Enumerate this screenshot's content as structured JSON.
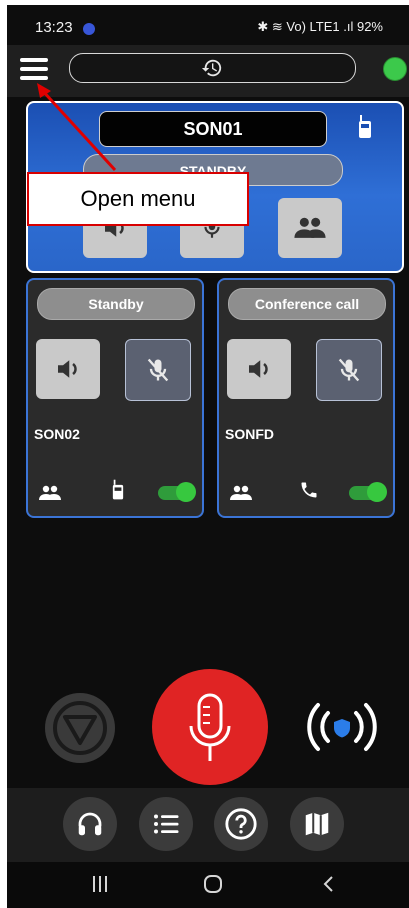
{
  "status_bar": {
    "time": "13:23",
    "right": "✱ ≋ Vo) LTE1 .ıl 92%",
    "battery_percent": 92
  },
  "top_bar": {
    "menu_icon": "hamburger-menu-icon",
    "history_icon": "history-clock-icon",
    "connection_color": "#3cc94b"
  },
  "main_channel": {
    "name": "SON01",
    "status": "STANDBY",
    "device_icon": "walkie-talkie-icon"
  },
  "annotation": {
    "callout": "Open menu"
  },
  "channels": [
    {
      "status": "Standby",
      "name": "SON02",
      "speaker_icon": "speaker-icon",
      "mic_icon": "mic-muted-icon",
      "bottom_icons": [
        "group-icon",
        "walkie-talkie-icon"
      ],
      "toggle_on": true
    },
    {
      "status": "Conference call",
      "name": "SONFD",
      "speaker_icon": "speaker-icon",
      "mic_icon": "mic-muted-icon",
      "bottom_icons": [
        "group-icon",
        "phone-icon"
      ],
      "toggle_on": true
    }
  ],
  "controls": {
    "stop_icon": "stop-icon",
    "ptt_icon": "microphone-icon",
    "signal_icon": "broadcast-shield-icon",
    "ptt_color": "#e02424"
  },
  "bottom_nav": [
    "headset-icon",
    "list-icon",
    "help-icon",
    "map-icon"
  ],
  "system_nav": [
    "recents-icon",
    "home-icon",
    "back-icon"
  ],
  "colors": {
    "accent_blue": "#3b74d6",
    "background": "#0d0d0d"
  }
}
